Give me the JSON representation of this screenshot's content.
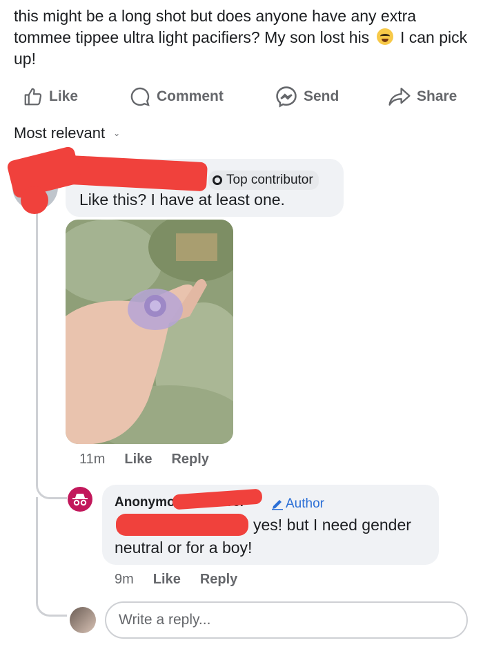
{
  "post": {
    "text_before_emoji": "this might be a long shot but does anyone have any extra tommee tippee ultra light pacifiers? My son lost his",
    "text_after_emoji": "I can pick up!",
    "emoji_icon": "crying-face-icon"
  },
  "actions": {
    "like": "Like",
    "comment": "Comment",
    "send": "Send",
    "share": "Share"
  },
  "sort": {
    "label": "Most relevant"
  },
  "comments": [
    {
      "badge": "Top contributor",
      "text": "Like this? I have at least one.",
      "has_photo": true,
      "time": "11m",
      "like": "Like",
      "reply": "Reply"
    }
  ],
  "replies": [
    {
      "name": "Anonymous member",
      "author_label": "Author",
      "text_line1": "yes! but I need gender",
      "text_line2": "neutral or for a boy!",
      "time": "9m",
      "like": "Like",
      "reply": "Reply"
    }
  ],
  "reply_input": {
    "placeholder": "Write a reply..."
  },
  "colors": {
    "redaction": "#f0413c",
    "author_blue": "#2b6fd6",
    "anon_avatar": "#c2185b",
    "muted": "#65676b"
  }
}
